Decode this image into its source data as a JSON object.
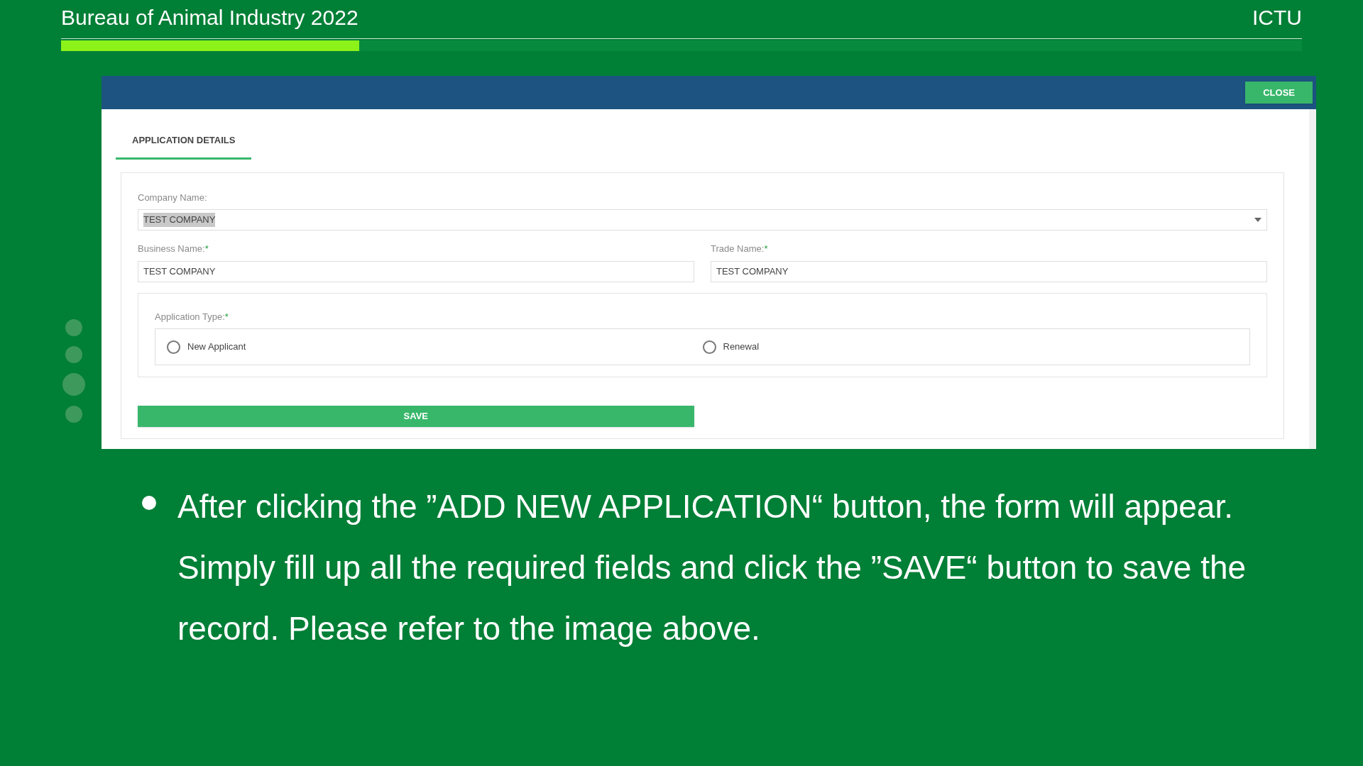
{
  "header": {
    "title": "Bureau of Animal Industry 2022",
    "org": "ICTU",
    "progress": {
      "level": 0.24
    }
  },
  "slide_dots": [
    {
      "selected": false
    },
    {
      "selected": false
    },
    {
      "selected": true
    },
    {
      "selected": false
    }
  ],
  "form_window": {
    "close_button": "CLOSE",
    "tabs": [
      {
        "label": "APPLICATION DETAILS",
        "selected": true
      }
    ],
    "company_name": {
      "label": "Company Name:",
      "value": "TEST COMPANY",
      "highlighted": true
    },
    "business_name": {
      "label": "Business Name:",
      "required": true,
      "required_mark": "*",
      "value": "TEST COMPANY"
    },
    "trade_name": {
      "label": "Trade Name:",
      "required": true,
      "required_mark": "*",
      "value": "TEST COMPANY"
    },
    "application_type": {
      "label": "Application Type:",
      "required": true,
      "required_mark": "*",
      "options": [
        {
          "label": "New Applicant",
          "checked": false
        },
        {
          "label": "Renewal",
          "checked": false
        }
      ]
    },
    "save_button": "SAVE"
  },
  "bullets": [
    "After clicking the ”ADD NEW APPLICATION“ button, the form will appear. Simply fill up all the required fields and click the ”SAVE“ button to save the record. Please refer to the image above."
  ]
}
